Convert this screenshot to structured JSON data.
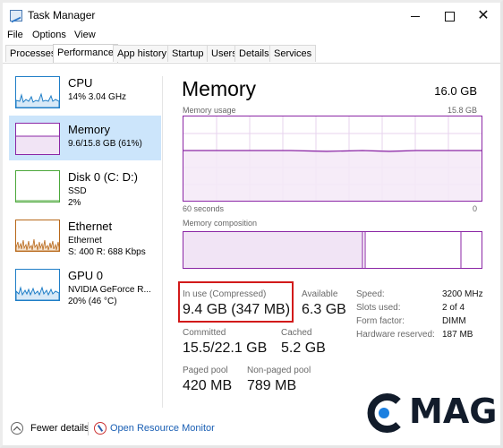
{
  "window": {
    "title": "Task Manager"
  },
  "menu": [
    "File",
    "Options",
    "View"
  ],
  "tabs": [
    {
      "label": "Processes"
    },
    {
      "label": "Performance"
    },
    {
      "label": "App history"
    },
    {
      "label": "Startup"
    },
    {
      "label": "Users"
    },
    {
      "label": "Details"
    },
    {
      "label": "Services"
    }
  ],
  "active_tab": "Performance",
  "resources": [
    {
      "name": "CPU",
      "line1": "14% 3.04 GHz",
      "line2": "",
      "color": "#1f7ec7",
      "selected": false
    },
    {
      "name": "Memory",
      "line1": "9.6/15.8 GB (61%)",
      "line2": "",
      "color": "#8b26a5",
      "selected": true
    },
    {
      "name": "Disk 0 (C: D:)",
      "line1": "SSD",
      "line2": "2%",
      "color": "#4ca83b",
      "selected": false
    },
    {
      "name": "Ethernet",
      "line1": "Ethernet",
      "line2": "S: 400 R: 688 Kbps",
      "color": "#b8681a",
      "selected": false
    },
    {
      "name": "GPU 0",
      "line1": "NVIDIA GeForce R...",
      "line2": "20% (46 °C)",
      "color": "#1f7ec7",
      "selected": false
    }
  ],
  "memory": {
    "title": "Memory",
    "total": "16.0 GB",
    "usage_label": "Memory usage",
    "usage_max": "15.8 GB",
    "time_left": "60 seconds",
    "time_right": "0",
    "usage_level": 0.6,
    "composition_label": "Memory composition",
    "composition": {
      "in_use": 0.6,
      "modified": 0.01,
      "standby": 0.32,
      "free": 0.07
    }
  },
  "stats": {
    "in_use_label": "In use (Compressed)",
    "in_use_value": "9.4 GB (347 MB)",
    "available_label": "Available",
    "available_value": "6.3 GB",
    "committed_label": "Committed",
    "committed_value": "15.5/22.1 GB",
    "cached_label": "Cached",
    "cached_value": "5.2 GB",
    "paged_label": "Paged pool",
    "paged_value": "420 MB",
    "nonpaged_label": "Non-paged pool",
    "nonpaged_value": "789 MB"
  },
  "specs": [
    {
      "label": "Speed:",
      "value": "3200 MHz"
    },
    {
      "label": "Slots used:",
      "value": "2 of 4"
    },
    {
      "label": "Form factor:",
      "value": "DIMM"
    },
    {
      "label": "Hardware reserved:",
      "value": "187 MB"
    }
  ],
  "footer": {
    "fewer_details": "Fewer details",
    "open_resource_monitor": "Open Resource Monitor"
  },
  "logo": {
    "text": "MAG",
    "prefix_letter": "C"
  },
  "colors": {
    "memory_accent": "#8b26a5",
    "highlight": "#d21a1a",
    "link": "#1a5fb4",
    "selected_bg": "#cce5fb"
  }
}
